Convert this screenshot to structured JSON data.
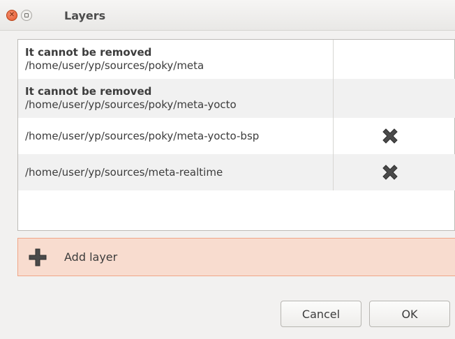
{
  "window": {
    "title": "Layers"
  },
  "layers": [
    {
      "note": "It cannot be removed",
      "path": "/home/user/yp/sources/poky/meta",
      "removable": false
    },
    {
      "note": "It cannot be removed",
      "path": "/home/user/yp/sources/poky/meta-yocto",
      "removable": false
    },
    {
      "note": "",
      "path": "/home/user/yp/sources/poky/meta-yocto-bsp",
      "removable": true
    },
    {
      "note": "",
      "path": "/home/user/yp/sources/meta-realtime",
      "removable": true
    }
  ],
  "add_layer": {
    "label": "Add layer",
    "icon": "plus-icon"
  },
  "buttons": {
    "cancel": "Cancel",
    "ok": "OK"
  },
  "colors": {
    "add_bg": "#f8dccf",
    "add_border": "#f0a587",
    "close": "#e5582e"
  }
}
